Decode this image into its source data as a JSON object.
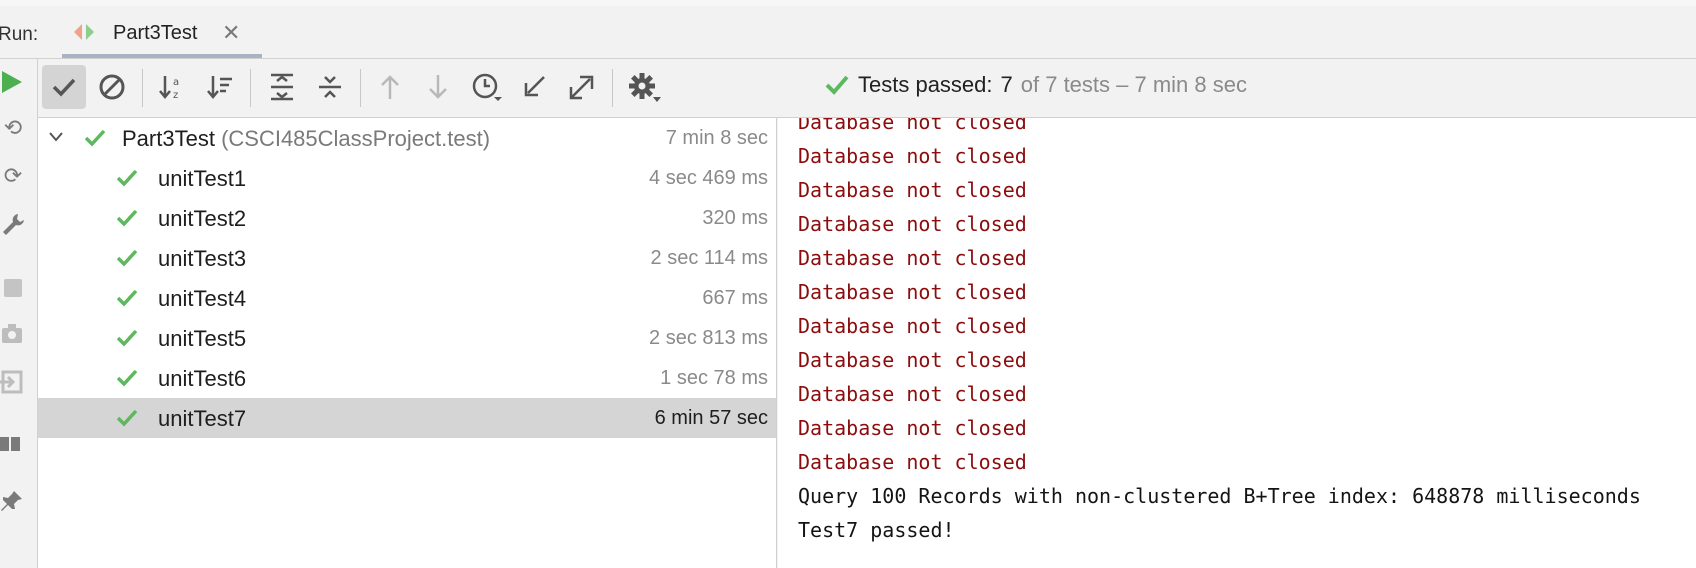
{
  "run": {
    "label": "Run:",
    "tab_title": "Part3Test"
  },
  "status": {
    "prefix": "Tests passed:",
    "passed": "7",
    "rest": "of 7 tests – 7 min 8 sec",
    "color_pass": "#5fb85f"
  },
  "toolbar": {
    "buttons": [
      "show-passed",
      "show-ignored",
      "sort-alphabetically",
      "sort-by-duration",
      "expand-all",
      "collapse-all",
      "previous-failed",
      "next-failed",
      "test-history",
      "import-tests",
      "export-results",
      "settings"
    ]
  },
  "tree": {
    "root": {
      "name": "Part3Test",
      "package": "(CSCI485ClassProject.test)",
      "time": "7 min 8 sec"
    },
    "tests": [
      {
        "name": "unitTest1",
        "time": "4 sec 469 ms"
      },
      {
        "name": "unitTest2",
        "time": "320 ms"
      },
      {
        "name": "unitTest3",
        "time": "2 sec 114 ms"
      },
      {
        "name": "unitTest4",
        "time": "667 ms"
      },
      {
        "name": "unitTest5",
        "time": "2 sec 813 ms"
      },
      {
        "name": "unitTest6",
        "time": "1 sec 78 ms"
      },
      {
        "name": "unitTest7",
        "time": "6 min 57 sec"
      }
    ],
    "selected_index": 6
  },
  "console": {
    "lines": [
      "Database not closed",
      "Database not closed",
      "Database not closed",
      "Database not closed",
      "Database not closed",
      "Database not closed",
      "Database not closed",
      "Database not closed",
      "Database not closed",
      "Database not closed",
      "Database not closed",
      "Query 100 Records with non-clustered B+Tree index: 648878 milliseconds",
      "Test7 passed!"
    ],
    "error_color": "#8b0d0d"
  }
}
